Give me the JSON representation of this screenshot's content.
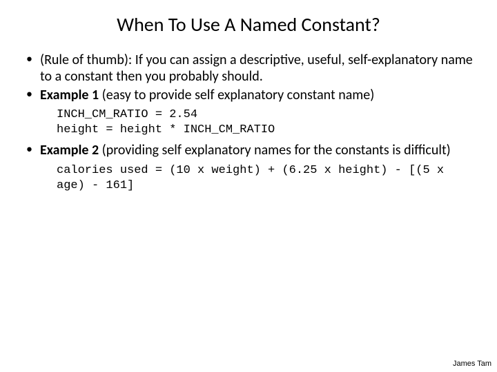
{
  "title": "When To Use A Named Constant?",
  "bullets": {
    "b1": "(Rule of thumb): If you can assign a descriptive, useful, self-explanatory name to a constant then you probably should.",
    "b2_bold": "Example 1",
    "b2_rest": " (easy to provide self explanatory constant name)",
    "b3_bold": "Example 2",
    "b3_rest": " (providing self explanatory names for the constants is difficult)"
  },
  "code1": "INCH_CM_RATIO = 2.54\nheight = height * INCH_CM_RATIO",
  "code2": "calories used = (10 x weight) + (6.25 x height) - [(5 x age) - 161]",
  "footer": "James Tam"
}
